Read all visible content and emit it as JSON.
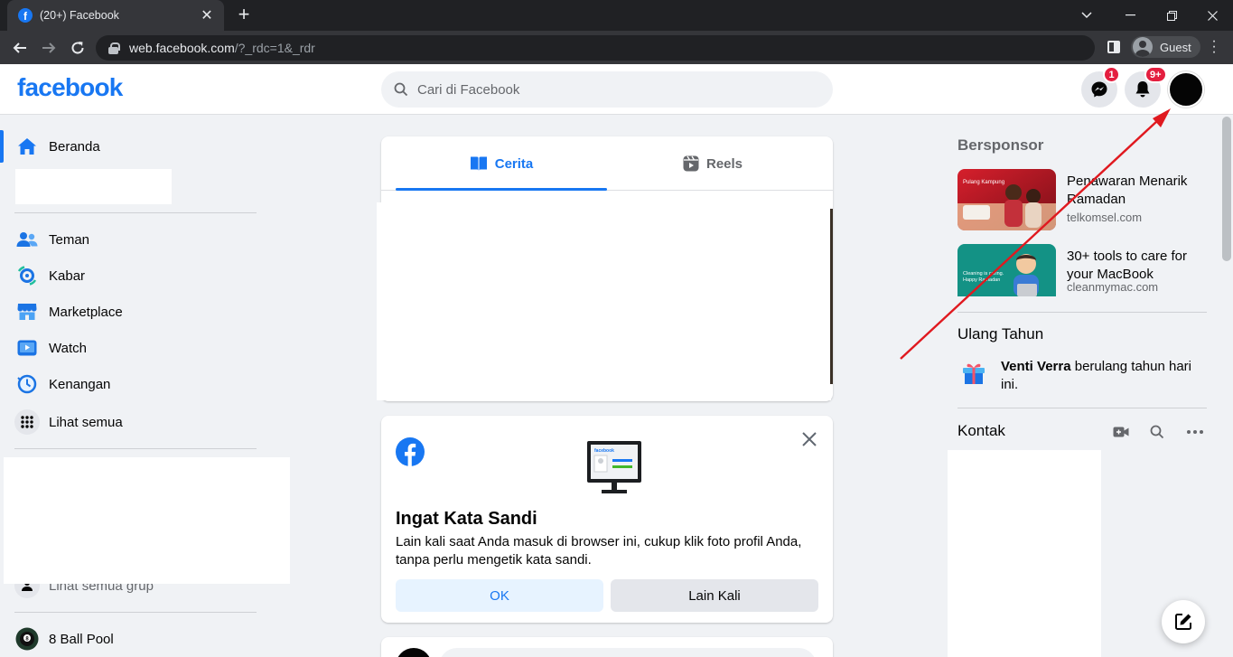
{
  "browser": {
    "tab_title": "(20+) Facebook",
    "url_host": "web.facebook.com",
    "url_path": "/?_rdc=1&_rdr",
    "profile_label": "Guest"
  },
  "header": {
    "logo": "facebook",
    "search_placeholder": "Cari di Facebook",
    "messenger_badge": "1",
    "notifications_badge": "9+"
  },
  "sidebar": {
    "items": [
      {
        "label": "Beranda",
        "icon": "home-icon"
      },
      {
        "label": "Teman",
        "icon": "friends-icon"
      },
      {
        "label": "Kabar",
        "icon": "feeds-icon"
      },
      {
        "label": "Marketplace",
        "icon": "marketplace-icon"
      },
      {
        "label": "Watch",
        "icon": "watch-icon"
      },
      {
        "label": "Kenangan",
        "icon": "memories-icon"
      },
      {
        "label": "Lihat semua",
        "icon": "grid-icon"
      }
    ],
    "groups_see_all": "Lihat semua grup",
    "shortcut": "8 Ball Pool"
  },
  "stories": {
    "tabs": [
      "Cerita",
      "Reels"
    ],
    "active_tab": "Cerita"
  },
  "password_prompt": {
    "title": "Ingat Kata Sandi",
    "text": "Lain kali saat Anda masuk di browser ini, cukup klik foto profil Anda, tanpa perlu mengetik kata sandi.",
    "ok_label": "OK",
    "later_label": "Lain Kali"
  },
  "right": {
    "sponsored_title": "Bersponsor",
    "ads": [
      {
        "title": "Penawaran Menarik Ramadan",
        "domain": "telkomsel.com"
      },
      {
        "title": "30+ tools to care for your MacBook",
        "domain": "cleanmymac.com"
      }
    ],
    "birthdays_title": "Ulang Tahun",
    "birthday_name": "Venti Verra",
    "birthday_text": " berulang tahun hari ini.",
    "contacts_title": "Kontak"
  },
  "colors": {
    "brand": "#1877f2",
    "badge": "#e41e3f",
    "annotation_arrow": "#e0191f"
  }
}
